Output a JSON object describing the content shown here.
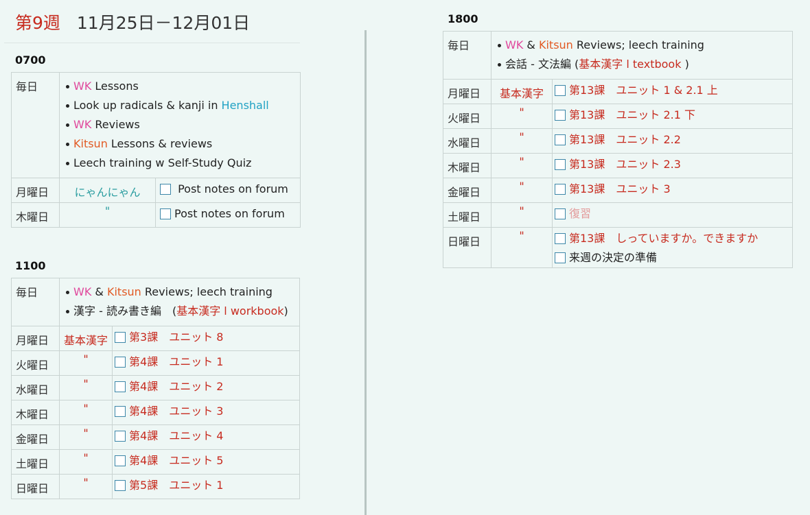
{
  "header": {
    "week": "第9週",
    "dates": "11月25日－12月01日"
  },
  "slots": {
    "s0700": {
      "time": "0700",
      "daily_label": "毎日",
      "daily": [
        "Lessons",
        "Look up radicals & kanji in",
        "Henshall",
        "Reviews",
        "Lessons & reviews",
        "Leech training w Self-Study Quiz"
      ],
      "wk": "WK",
      "kitsun": "Kitsun",
      "rows": [
        {
          "day": "月曜日",
          "cat": "にゃんにゃん",
          "task": "Post notes on forum"
        },
        {
          "day": "木曜日",
          "cat": "\"",
          "task": "Post notes on forum"
        }
      ]
    },
    "s1100": {
      "time": "1100",
      "daily_label": "毎日",
      "wk": "WK",
      "amp": "&",
      "kitsun": "Kitsun",
      "reviews": "Reviews; leech training",
      "kanji_pre": "漢字 - 読み書き編　(",
      "kanji_book": "基本漢字 l workbook",
      "kanji_post": ")",
      "rows": [
        {
          "day": "月曜日",
          "cat": "基本漢字",
          "task": "第3課　ユニット 8"
        },
        {
          "day": "火曜日",
          "cat": "\"",
          "task": "第4課　ユニット 1"
        },
        {
          "day": "水曜日",
          "cat": "\"",
          "task": "第4課　ユニット 2"
        },
        {
          "day": "木曜日",
          "cat": "\"",
          "task": "第4課　ユニット 3"
        },
        {
          "day": "金曜日",
          "cat": "\"",
          "task": "第4課　ユニット 4"
        },
        {
          "day": "土曜日",
          "cat": "\"",
          "task": "第4課　ユニット 5"
        },
        {
          "day": "日曜日",
          "cat": "\"",
          "task": "第5課　ユニット 1"
        }
      ]
    },
    "s1800": {
      "time": "1800",
      "daily_label": "毎日",
      "wk": "WK",
      "amp": "&",
      "kitsun": "Kitsun",
      "reviews": "Reviews; leech training",
      "grammar_pre": "会話 - 文法編 (",
      "grammar_book": "基本漢字 l textbook",
      "grammar_post": " )",
      "rows": [
        {
          "day": "月曜日",
          "cat": "基本漢字",
          "task": "第13課　ユニット 1 & 2.1 上"
        },
        {
          "day": "火曜日",
          "cat": "\"",
          "task": "第13課　ユニット 2.1 下"
        },
        {
          "day": "水曜日",
          "cat": "\"",
          "task": "第13課　ユニット 2.2"
        },
        {
          "day": "木曜日",
          "cat": "\"",
          "task": "第13課　ユニット 2.3"
        },
        {
          "day": "金曜日",
          "cat": "\"",
          "task": "第13課　ユニット 3"
        },
        {
          "day": "土曜日",
          "cat": "\"",
          "task": "復習"
        },
        {
          "day": "日曜日",
          "cat": "\"",
          "task": "第13課　しっていますか。できますか",
          "task2": "来週の決定の準備"
        }
      ]
    }
  }
}
